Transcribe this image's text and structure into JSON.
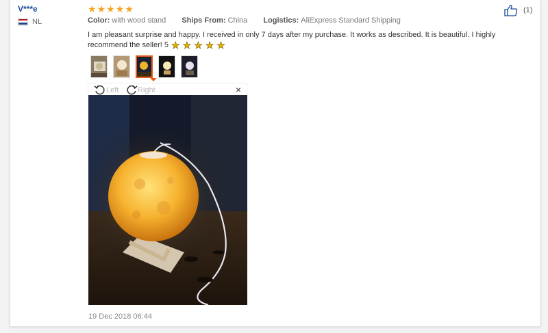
{
  "review": {
    "user": "V***e",
    "country": "NL",
    "rating_stars": 5,
    "color_label": "Color:",
    "color_value": "with wood stand",
    "ships_label": "Ships From:",
    "ships_value": "China",
    "logistics_label": "Logistics:",
    "logistics_value": "AliExpress Standard Shipping",
    "text": "I am pleasant surprise and happy. I received in only 7 days after my purchase. It works as described. It is beautiful. I highly recommend the seller! 5",
    "likes": "(1)",
    "date": "19 Dec 2018 06:44"
  },
  "viewer": {
    "rotate_left": "Left",
    "rotate_right": "Right",
    "close": "×"
  },
  "icons": {
    "star": "★",
    "like": "thumbs-up-icon"
  },
  "colors": {
    "accent": "#e85d1b",
    "star": "#f5a623",
    "user": "#1a4c9c"
  }
}
